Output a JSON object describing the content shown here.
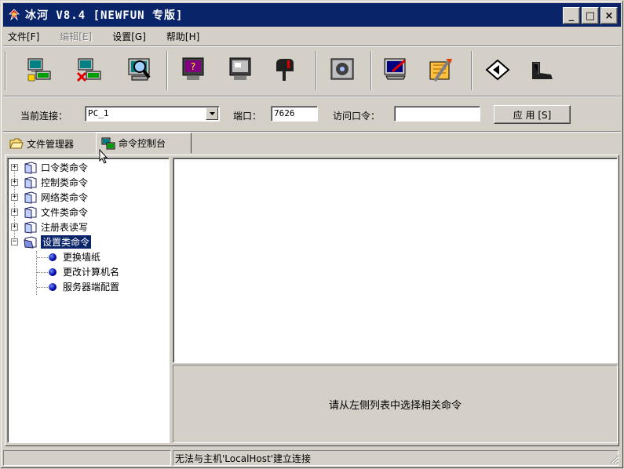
{
  "window": {
    "title": "冰河 V8.4 [NEWFUN 专版]",
    "controls": {
      "minimize": "_",
      "maximize": "□",
      "close": "×"
    }
  },
  "menu": [
    {
      "label": "文件[F]",
      "enabled": true
    },
    {
      "label": "编辑[E]",
      "enabled": false
    },
    {
      "label": "设置[G]",
      "enabled": true
    },
    {
      "label": "帮助[H]",
      "enabled": true
    }
  ],
  "toolbar": {
    "icons": [
      "add-host-icon",
      "delete-host-icon",
      "search-host-icon",
      "remote-screen-icon",
      "screen-control-icon",
      "mailbox-icon",
      "settings-icon",
      "config-server-icon",
      "tools-icon",
      "home-icon",
      "exit-icon"
    ]
  },
  "connection": {
    "current_label": "当前连接：",
    "current_value": "PC_1",
    "port_label": "端口：",
    "port_value": "7626",
    "password_label": "访问口令：",
    "password_value": "",
    "apply_label": "应 用 [S]"
  },
  "tabs": [
    {
      "label": "文件管理器",
      "icon": "folder-icon",
      "active": false
    },
    {
      "label": "命令控制台",
      "icon": "console-icon",
      "active": true
    }
  ],
  "tree": {
    "categories": [
      {
        "label": "口令类命令",
        "expanded": false
      },
      {
        "label": "控制类命令",
        "expanded": false
      },
      {
        "label": "网络类命令",
        "expanded": false
      },
      {
        "label": "文件类命令",
        "expanded": false
      },
      {
        "label": "注册表读写",
        "expanded": false
      },
      {
        "label": "设置类命令",
        "expanded": true,
        "selected": true
      }
    ],
    "children": [
      "更换墙纸",
      "更改计算机名",
      "服务器端配置"
    ]
  },
  "hint_text": "请从左侧列表中选择相关命令",
  "status": {
    "left": "",
    "message": "无法与主机'LocalHost'建立连接"
  },
  "colors": {
    "titlebar": "#0a246a",
    "face": "#d4d0c8",
    "selection": "#0a246a"
  }
}
